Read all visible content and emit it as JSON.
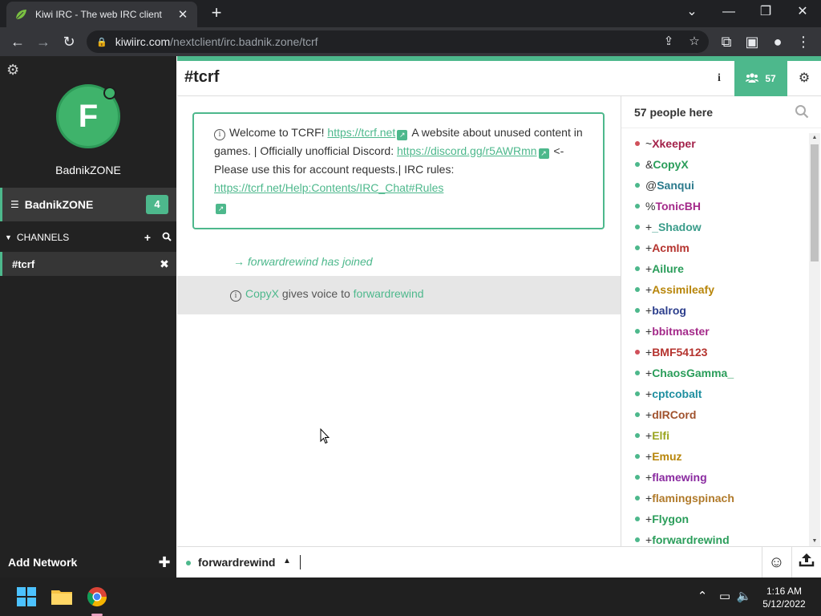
{
  "browser": {
    "tab_title": "Kiwi IRC - The web IRC client",
    "url_host": "kiwiirc.com",
    "url_path": "/nextclient/irc.badnik.zone/tcrf"
  },
  "sidebar": {
    "avatar_letter": "F",
    "network_display": "BadnikZONE",
    "network_name": "BadnikZONE",
    "network_badge": "4",
    "channels_label": "CHANNELS",
    "channel": "#tcrf",
    "add_network": "Add Network"
  },
  "header": {
    "channel": "#tcrf",
    "user_count": "57"
  },
  "topic": {
    "t1": "Welcome to TCRF! ",
    "link1": "https://tcrf.net",
    "t2": " A website about unused content in games. | Officially unofficial Discord: ",
    "link2": "https://discord.gg/r5AWRmn",
    "t3": " <- Please use this for account requests.| IRC rules: ",
    "link3": "https://tcrf.net/Help:Contents/IRC_Chat#Rules"
  },
  "messages": {
    "join": "→ forwardrewind has joined",
    "voice_setter": "CopyX",
    "voice_text": " gives voice to ",
    "voice_target": "forwardrewind"
  },
  "nicklist": {
    "title": "57 people here",
    "users": [
      {
        "prefix": "~",
        "nick": "Xkeeper",
        "color": "#a3224a",
        "away": true
      },
      {
        "prefix": "&",
        "nick": "CopyX",
        "color": "#2a9d5a",
        "away": false
      },
      {
        "prefix": "@",
        "nick": "Sanqui",
        "color": "#2b7a8c",
        "away": false
      },
      {
        "prefix": "%",
        "nick": "TonicBH",
        "color": "#a42a8a",
        "away": false
      },
      {
        "prefix": "+",
        "nick": "_Shadow",
        "color": "#3a9c8a",
        "away": false
      },
      {
        "prefix": "+",
        "nick": "AcmIm",
        "color": "#b5342f",
        "away": false
      },
      {
        "prefix": "+",
        "nick": "Ailure",
        "color": "#2a9d5a",
        "away": false
      },
      {
        "prefix": "+",
        "nick": "Assimileafy",
        "color": "#b8860b",
        "away": false
      },
      {
        "prefix": "+",
        "nick": "balrog",
        "color": "#2c3e8c",
        "away": false
      },
      {
        "prefix": "+",
        "nick": "bbitmaster",
        "color": "#a42a8a",
        "away": false
      },
      {
        "prefix": "+",
        "nick": "BMF54123",
        "color": "#b5342f",
        "away": true
      },
      {
        "prefix": "+",
        "nick": "ChaosGamma_",
        "color": "#2a9d5a",
        "away": false
      },
      {
        "prefix": "+",
        "nick": "cptcobalt",
        "color": "#1f8fa0",
        "away": false
      },
      {
        "prefix": "+",
        "nick": "dIRCord",
        "color": "#a0522d",
        "away": false
      },
      {
        "prefix": "+",
        "nick": "Elfi",
        "color": "#9aa520",
        "away": false
      },
      {
        "prefix": "+",
        "nick": "Emuz",
        "color": "#b8860b",
        "away": false
      },
      {
        "prefix": "+",
        "nick": "flamewing",
        "color": "#8a2aa0",
        "away": false
      },
      {
        "prefix": "+",
        "nick": "flamingspinach",
        "color": "#b07a2a",
        "away": false
      },
      {
        "prefix": "+",
        "nick": "Flygon",
        "color": "#2a9d5a",
        "away": false
      },
      {
        "prefix": "+",
        "nick": "forwardrewind",
        "color": "#2a9d5a",
        "away": false
      }
    ]
  },
  "input": {
    "nick": "forwardrewind"
  },
  "taskbar": {
    "time": "1:16 AM",
    "date": "5/12/2022"
  },
  "colors": {
    "accent": "#4db88c",
    "sidebar_bg": "#222222"
  },
  "icons": [
    "settings-gear-icon",
    "users-icon",
    "info-icon",
    "search-icon",
    "emoji-icon",
    "upload-icon",
    "add-icon",
    "close-icon"
  ]
}
